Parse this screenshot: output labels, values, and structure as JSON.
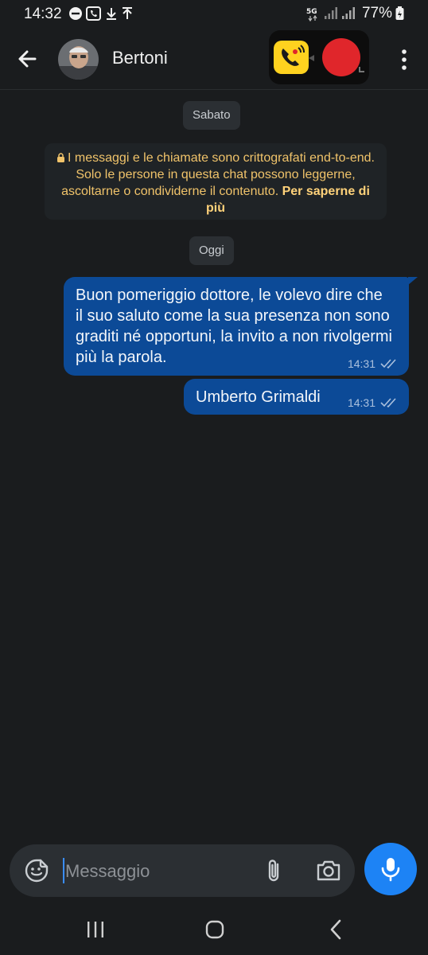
{
  "status_bar": {
    "time": "14:32",
    "network": "5G",
    "battery": "77%"
  },
  "header": {
    "contact_name": "Bertoni"
  },
  "chat": {
    "date_chips": [
      "Sabato",
      "Oggi"
    ],
    "encryption_notice": {
      "text": "I messaggi e le chiamate sono crittografati end-to-end. Solo le persone in questa chat possono leggerne, ascoltarne o condividerne il contenuto.",
      "link": "Per saperne di più"
    },
    "messages": [
      {
        "text": "Buon pomeriggio dottore, le volevo dire che il suo saluto come la sua presenza non sono graditi né opportuni, la invito a non rivolgermi più la parola.",
        "time": "14:31"
      },
      {
        "text": "Umberto Grimaldi",
        "time": "14:31"
      }
    ]
  },
  "composer": {
    "placeholder": "Messaggio"
  },
  "colors": {
    "background": "#1a1c1e",
    "outgoing_bubble": "#0c4a97",
    "mic_button": "#1d83f5",
    "notice_text": "#f0c36a",
    "record_button": "#e0262b"
  }
}
